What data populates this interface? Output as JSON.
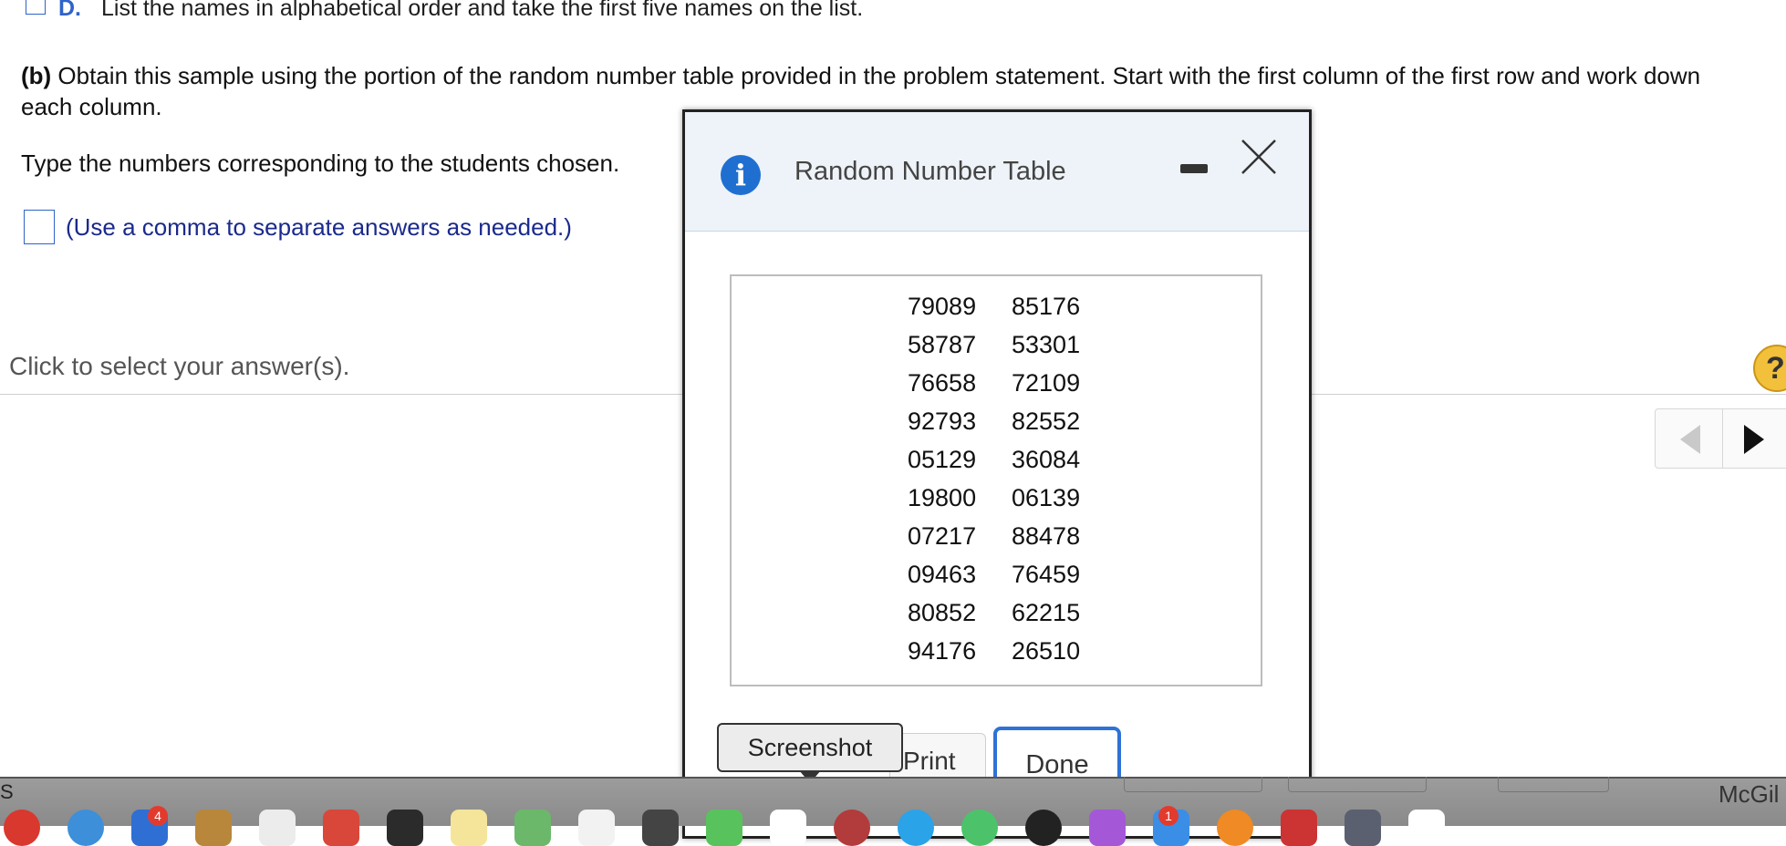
{
  "question": {
    "option_d": {
      "letter": "D.",
      "text": "List the names in alphabetical order and take the first five names on the list."
    },
    "part_b_label": "(b)",
    "part_b_text": " Obtain this sample using the portion of the random number table provided in the problem statement. Start with the first column of the first row and work down each column.",
    "type_numbers_text": "Type the numbers corresponding to the students chosen.",
    "answer_hint": "(Use a comma to separate answers as needed.)",
    "answer_value": "",
    "click_select_text": "Click to select your answer(s).",
    "help_glyph": "?"
  },
  "dialog": {
    "title": "Random Number Table",
    "info_glyph": "i",
    "rows": [
      [
        "79089",
        "85176"
      ],
      [
        "58787",
        "53301"
      ],
      [
        "76658",
        "72109"
      ],
      [
        "92793",
        "82552"
      ],
      [
        "05129",
        "36084"
      ],
      [
        "19800",
        "06139"
      ],
      [
        "07217",
        "88478"
      ],
      [
        "09463",
        "76459"
      ],
      [
        "80852",
        "62215"
      ],
      [
        "94176",
        "26510"
      ]
    ],
    "print_label": "Print",
    "done_label": "Done",
    "tooltip": "Screenshot"
  },
  "dock": {
    "left_label": "S",
    "right_label": "McGil",
    "badges": {
      "first": "4",
      "second": "1"
    },
    "icon_colors": [
      "#d8382e",
      "#3d8fd9",
      "#2f6fd4",
      "#b8873c",
      "#ececec",
      "#d9473a",
      "#2b2b2b",
      "#f4e59a",
      "#6cb86a",
      "#f2f2f2",
      "#444",
      "#58c35c",
      "#ffffff",
      "#b23b3b",
      "#2aa3e8",
      "#4cc36a",
      "#222",
      "#a458d8",
      "#3a8ee6",
      "#f08a24",
      "#c33",
      "#5a6070",
      "#ffffff"
    ]
  }
}
